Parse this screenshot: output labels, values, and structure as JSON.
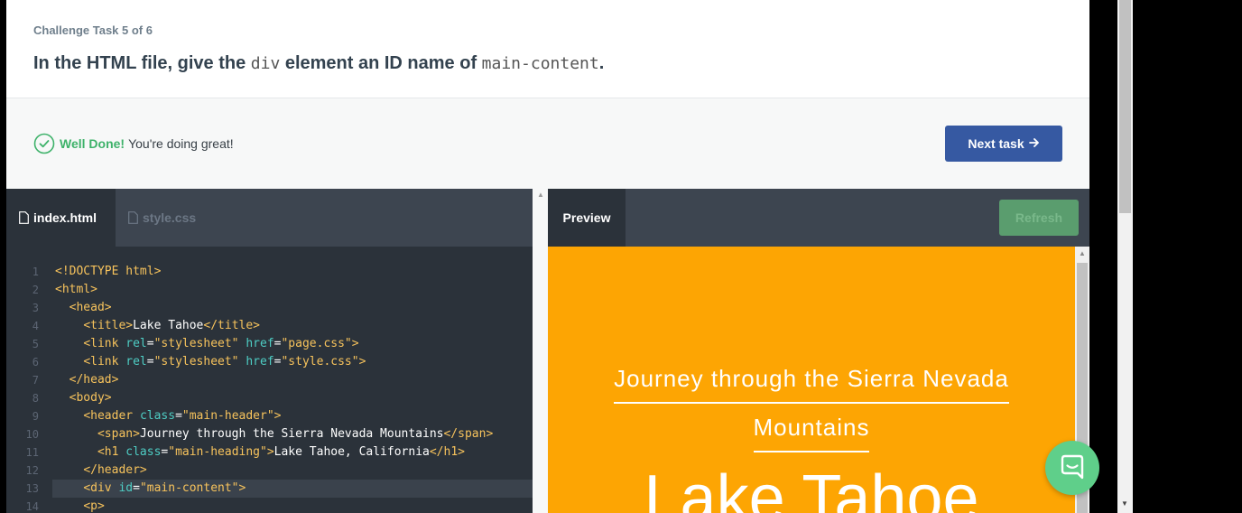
{
  "task": {
    "label": "Challenge Task 5 of 6",
    "text_before": "In the HTML file, give the ",
    "code1": "div",
    "text_mid": " element an ID name of ",
    "code2": "main-content",
    "text_after": "."
  },
  "feedback": {
    "strong": "Well Done!",
    "text": "You're doing great!",
    "next_label": "Next task"
  },
  "editor": {
    "tabs": [
      "index.html",
      "style.css"
    ],
    "active_tab": "index.html",
    "line_numbers": [
      "1",
      "2",
      "3",
      "4",
      "5",
      "6",
      "7",
      "8",
      "9",
      "10",
      "11",
      "12",
      "13",
      "14"
    ],
    "highlighted_line": "13"
  },
  "preview": {
    "tab_label": "Preview",
    "refresh_label": "Refresh",
    "subtitle_line1": "Journey through the Sierra Nevada",
    "subtitle_line2": "Mountains",
    "heading": "Lake Tahoe"
  },
  "colors": {
    "accent_button": "#3659a2",
    "success": "#3eb26a",
    "preview_bg": "#fda503",
    "chat_button": "#5fcf8a"
  },
  "icons": {
    "feedback": "check-circle-icon",
    "file": "file-icon",
    "chat": "chat-icon",
    "next": "arrow-right-icon"
  }
}
